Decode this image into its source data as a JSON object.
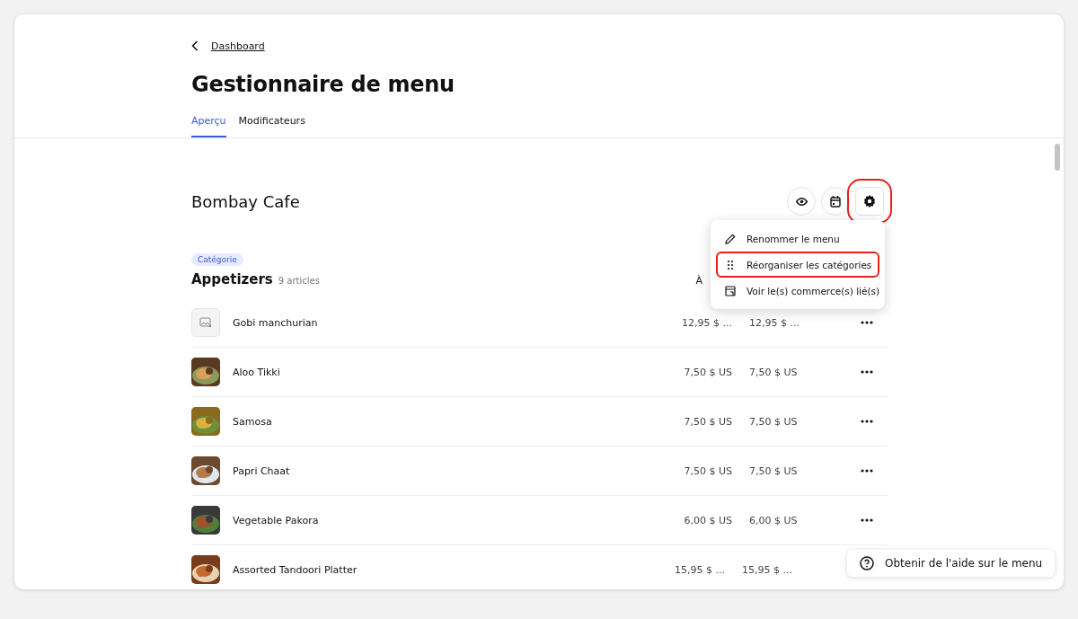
{
  "back_link": {
    "label": "Dashboard"
  },
  "title": "Gestionnaire de menu",
  "tabs": [
    {
      "label": "Aperçu",
      "selected": true
    },
    {
      "label": "Modificateurs",
      "selected": false
    }
  ],
  "menu": {
    "name": "Bombay Cafe",
    "actions": [
      {
        "kind": "preview",
        "highlighted": false
      },
      {
        "kind": "schedule",
        "highlighted": false
      },
      {
        "kind": "settings",
        "highlighted": true
      }
    ]
  },
  "dropdown": [
    {
      "kind": "rename",
      "label": "Renommer le menu",
      "highlighted": false
    },
    {
      "kind": "reorder",
      "label": "Réorganiser les catégories",
      "highlighted": true
    },
    {
      "kind": "stores",
      "label": "Voir le(s) commerce(s) lié(s)",
      "highlighted": false
    }
  ],
  "category": {
    "badge": "Catégorie",
    "name": "Appetizers",
    "count": "9 articles",
    "column_1": "À"
  },
  "items": [
    {
      "name": "Gobi manchurian",
      "kind": "placeholder",
      "price_1": "12,95 $ ...",
      "price_2": "12,95 $ ...",
      "more_button": true
    },
    {
      "name": "Aloo Tikki",
      "kind": "picture",
      "price_1": "7,50 $ US",
      "price_2": "7,50 $ US",
      "more_button": true
    },
    {
      "name": "Samosa",
      "kind": "picture",
      "price_1": "7,50 $ US",
      "price_2": "7,50 $ US",
      "more_button": true
    },
    {
      "name": "Papri Chaat",
      "kind": "picture",
      "price_1": "7,50 $ US",
      "price_2": "7,50 $ US",
      "more_button": true
    },
    {
      "name": "Vegetable Pakora",
      "kind": "picture",
      "price_1": "6,00 $ US",
      "price_2": "6,00 $ US",
      "more_button": true
    },
    {
      "name": "Assorted Tandoori Platter",
      "kind": "picture",
      "price_1": "15,95 $ ...",
      "price_2": "15,95 $ ...",
      "more_button": false
    }
  ],
  "help_button": {
    "label": "Obtenir de l'aide sur le menu"
  }
}
